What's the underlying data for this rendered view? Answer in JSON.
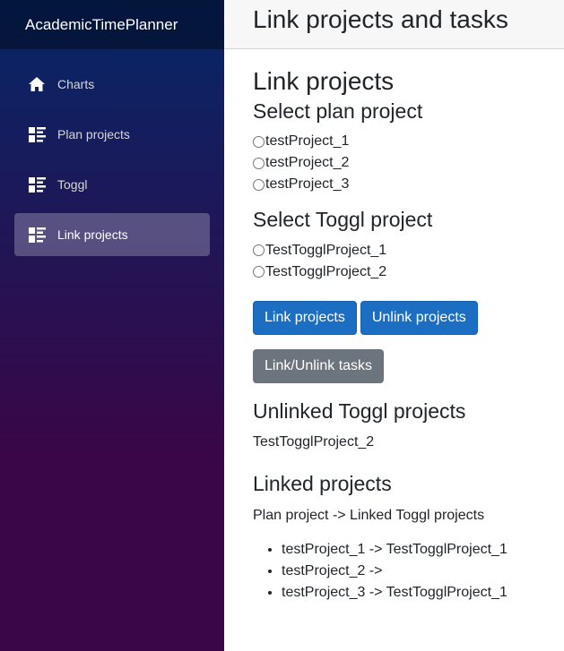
{
  "sidebar": {
    "brand": "AcademicTimePlanner",
    "items": [
      {
        "label": "Charts",
        "icon": "home-icon",
        "active": false
      },
      {
        "label": "Plan projects",
        "icon": "list-icon",
        "active": false
      },
      {
        "label": "Toggl",
        "icon": "list-icon",
        "active": false
      },
      {
        "label": "Link projects",
        "icon": "list-icon",
        "active": true
      }
    ]
  },
  "header": {
    "title": "Link projects and tasks"
  },
  "main": {
    "heading": "Link projects",
    "plan_section": {
      "title": "Select plan project",
      "options": [
        "testProject_1",
        "testProject_2",
        "testProject_3"
      ]
    },
    "toggl_section": {
      "title": "Select Toggl project",
      "options": [
        "TestTogglProject_1",
        "TestTogglProject_2"
      ]
    },
    "buttons": {
      "link": "Link projects",
      "unlink": "Unlink projects",
      "tasks": "Link/Unlink tasks"
    },
    "unlinked": {
      "title": "Unlinked Toggl projects",
      "items": [
        "TestTogglProject_2"
      ]
    },
    "linked": {
      "title": "Linked projects",
      "subtitle": "Plan project -> Linked Toggl projects",
      "items": [
        "testProject_1 -> TestTogglProject_1",
        "testProject_2 ->",
        "testProject_3 -> TestTogglProject_1"
      ]
    }
  },
  "colors": {
    "primary": "#1b6ec2",
    "secondary": "#6c757d",
    "sidebar_top": "#052767",
    "sidebar_bottom": "#3a0647"
  }
}
